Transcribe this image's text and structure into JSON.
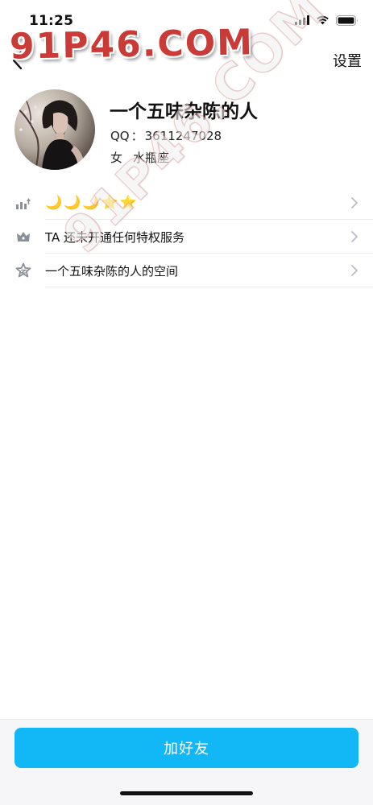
{
  "status_bar": {
    "time": "11:25"
  },
  "watermark": {
    "text": "91P46.COM",
    "diagonal_text": "91P46.COM"
  },
  "nav": {
    "settings_label": "设置"
  },
  "profile": {
    "nickname": "一个五味杂陈的人",
    "qq_label": "QQ",
    "qq_separator": "：",
    "qq_number": "3611247028",
    "gender": "女",
    "zodiac": "水瓶座"
  },
  "rows": [
    {
      "icon": "level-icon",
      "text": "",
      "level_glyphs": [
        "🌙",
        "🌙",
        "🌙",
        "⭐",
        "⭐"
      ]
    },
    {
      "icon": "vip-crown-icon",
      "text": "TA 还未开通任何特权服务"
    },
    {
      "icon": "qzone-star-icon",
      "text": "一个五味杂陈的人的空间"
    }
  ],
  "actions": {
    "add_friend_label": "加好友"
  },
  "colors": {
    "accent": "#12b7f5",
    "watermark_red": "#c8312d",
    "icon_gray": "#8a8f99",
    "divider": "#ececec"
  }
}
